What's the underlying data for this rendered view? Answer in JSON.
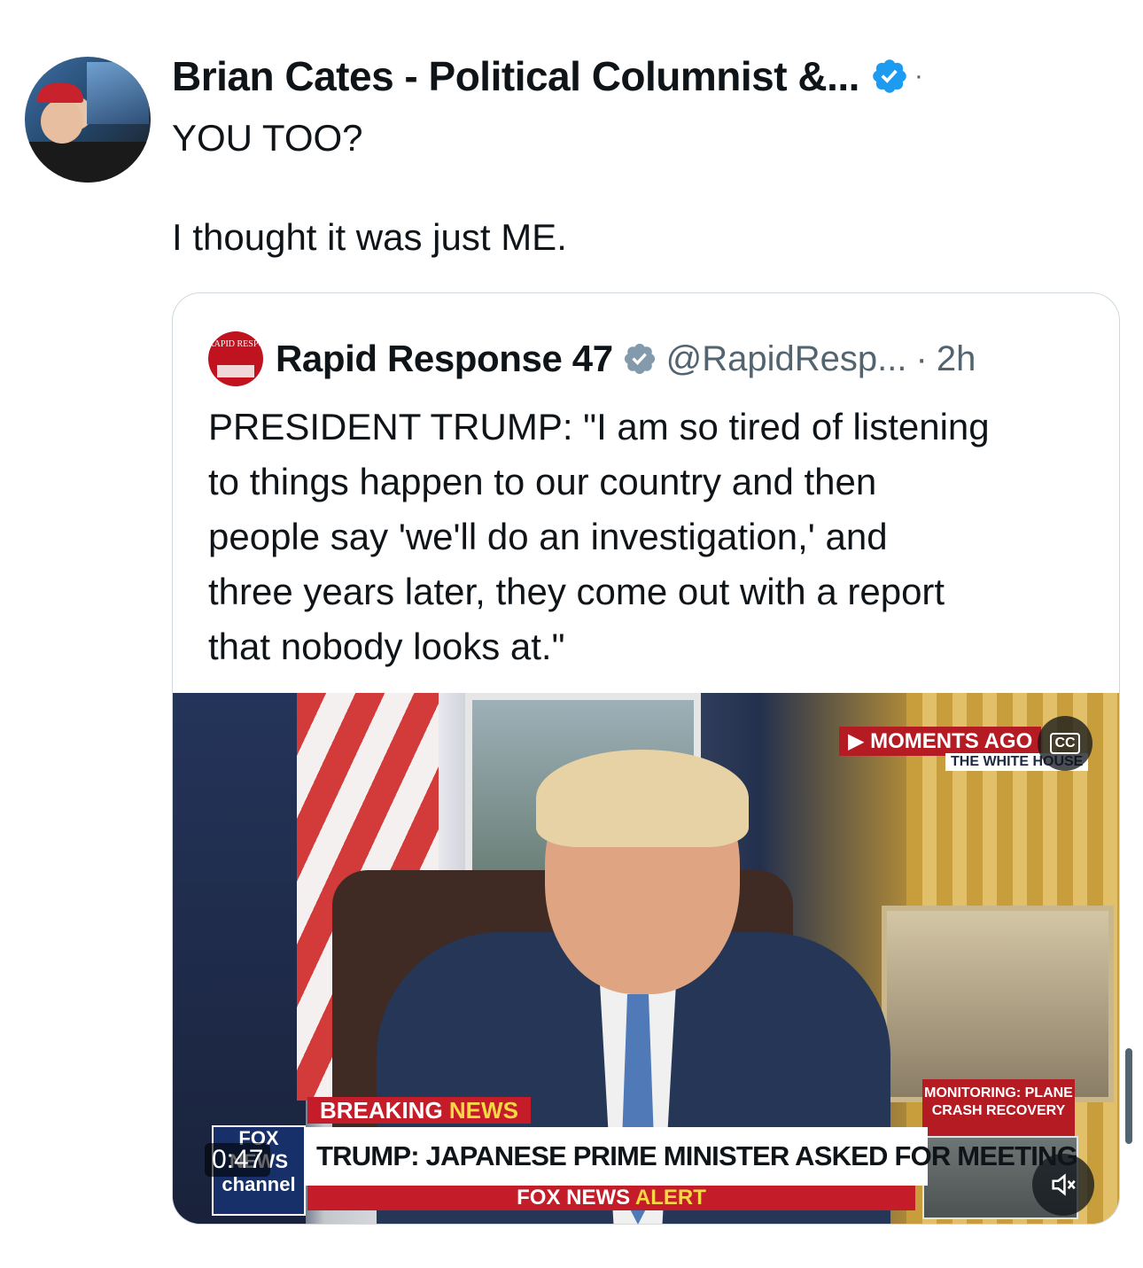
{
  "tweet": {
    "author_name": "Brian Cates - Political Columnist &...",
    "separator": "·",
    "text": "YOU TOO?\n\nI thought it was just ME.",
    "avatar_icon": "profile-photo",
    "verified_icon": "verified-badge-icon"
  },
  "quoted_tweet": {
    "avatar_label": "RAPID RESPONSE",
    "author_name": "Rapid Response 47",
    "handle": "@RapidResp...",
    "separator": "·",
    "time": "2h",
    "text": "PRESIDENT TRUMP: \"I am so tired of listening\nto things happen to our country and then\npeople say 'we'll do an investigation,' and\nthree years later, they come out with a report\nthat nobody looks at.\""
  },
  "video": {
    "duration": "0:47",
    "overlay_moments": "▶ MOMENTS AGO",
    "overlay_location": "THE WHITE HOUSE",
    "breaking_label_white": "BREAKING ",
    "breaking_label_yellow": "NEWS",
    "headline": "TRUMP: JAPANESE PRIME MINISTER ASKED FOR MEETING",
    "alert_white": "FOX NEWS ",
    "alert_yellow": "ALERT",
    "network_logo": "FOX NEWS channel",
    "side_box": "MONITORING: PLANE CRASH RECOVERY",
    "cc_label": "CC",
    "mute_icon": "speaker-muted-icon"
  },
  "colors": {
    "verified_blue": "#1d9bf0",
    "verified_gray": "#829aab",
    "text_secondary": "#536471",
    "border": "#cfd9de",
    "fox_red": "#c41c28"
  }
}
